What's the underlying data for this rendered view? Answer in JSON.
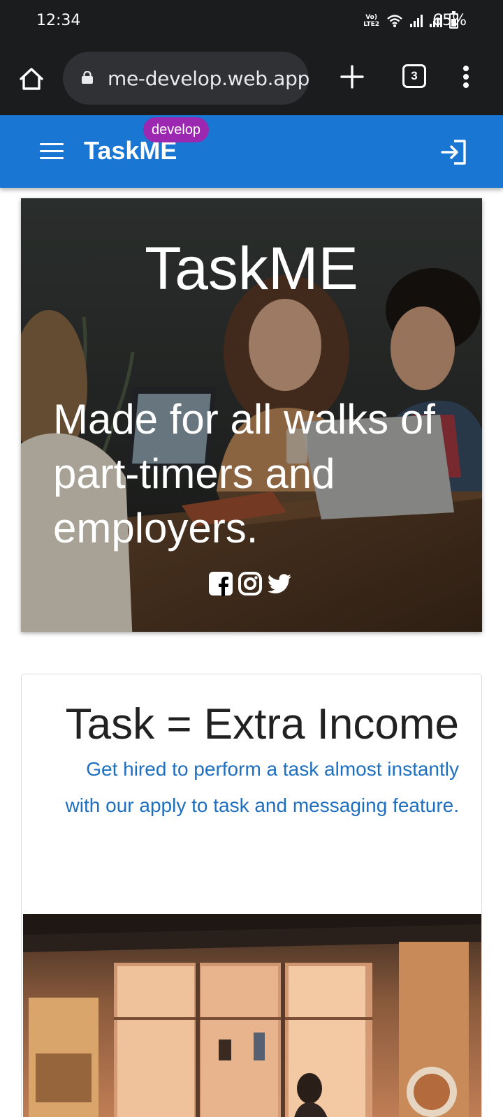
{
  "status_bar": {
    "time": "12:34",
    "volte_line1": "Vo)",
    "volte_line2": "LTE2",
    "battery": "65%"
  },
  "browser": {
    "url": "me-develop.web.app",
    "tab_count": "3",
    "icons": [
      "home-icon",
      "lock-icon",
      "plus-icon",
      "tabs-icon",
      "overflow-menu-icon"
    ]
  },
  "app_bar": {
    "title": "TaskME",
    "env_badge": "develop",
    "color": "#1976d2",
    "badge_color": "#9c27b0",
    "icons": [
      "hamburger-menu-icon",
      "login-icon"
    ]
  },
  "hero": {
    "title": "TaskME",
    "tagline": "Made for all walks of part-timers and employers.",
    "social": [
      "facebook-icon",
      "instagram-icon",
      "twitter-icon"
    ]
  },
  "feature": {
    "heading": "Task = Extra Income",
    "description": "Get hired to perform a task almost instantly with our apply to task and messaging feature.",
    "text_color": "#1f6fc0"
  }
}
